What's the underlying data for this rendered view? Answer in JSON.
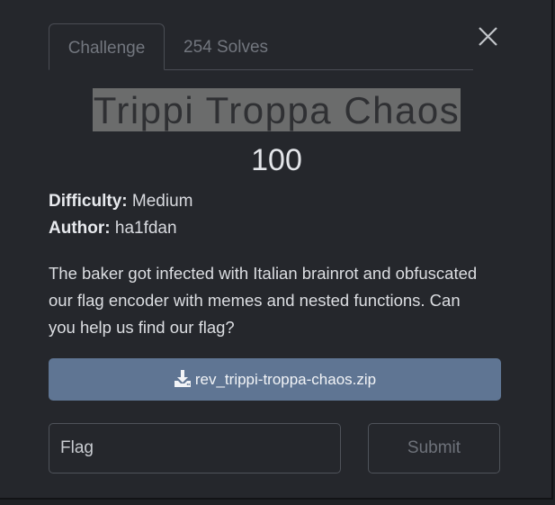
{
  "tabs": [
    {
      "label": "Challenge",
      "active": true
    },
    {
      "label": "254 Solves",
      "active": false
    }
  ],
  "close_icon": "close-icon",
  "challenge": {
    "title": "Trippi Troppa Chaos",
    "points": "100",
    "difficulty_label": "Difficulty:",
    "difficulty_value": "Medium",
    "author_label": "Author:",
    "author_value": "ha1fdan",
    "description": "The baker got infected with Italian brainrot and obfuscated our flag encoder with memes and nested functions. Can you help us find our flag?",
    "file_name": "rev_trippi-troppa-chaos.zip",
    "file_icon": "download-icon"
  },
  "form": {
    "flag_placeholder": "Flag",
    "submit_label": "Submit"
  },
  "colors": {
    "background": "#25272c",
    "download_button": "#5f7593",
    "title_highlight": "#6b6c6c"
  }
}
